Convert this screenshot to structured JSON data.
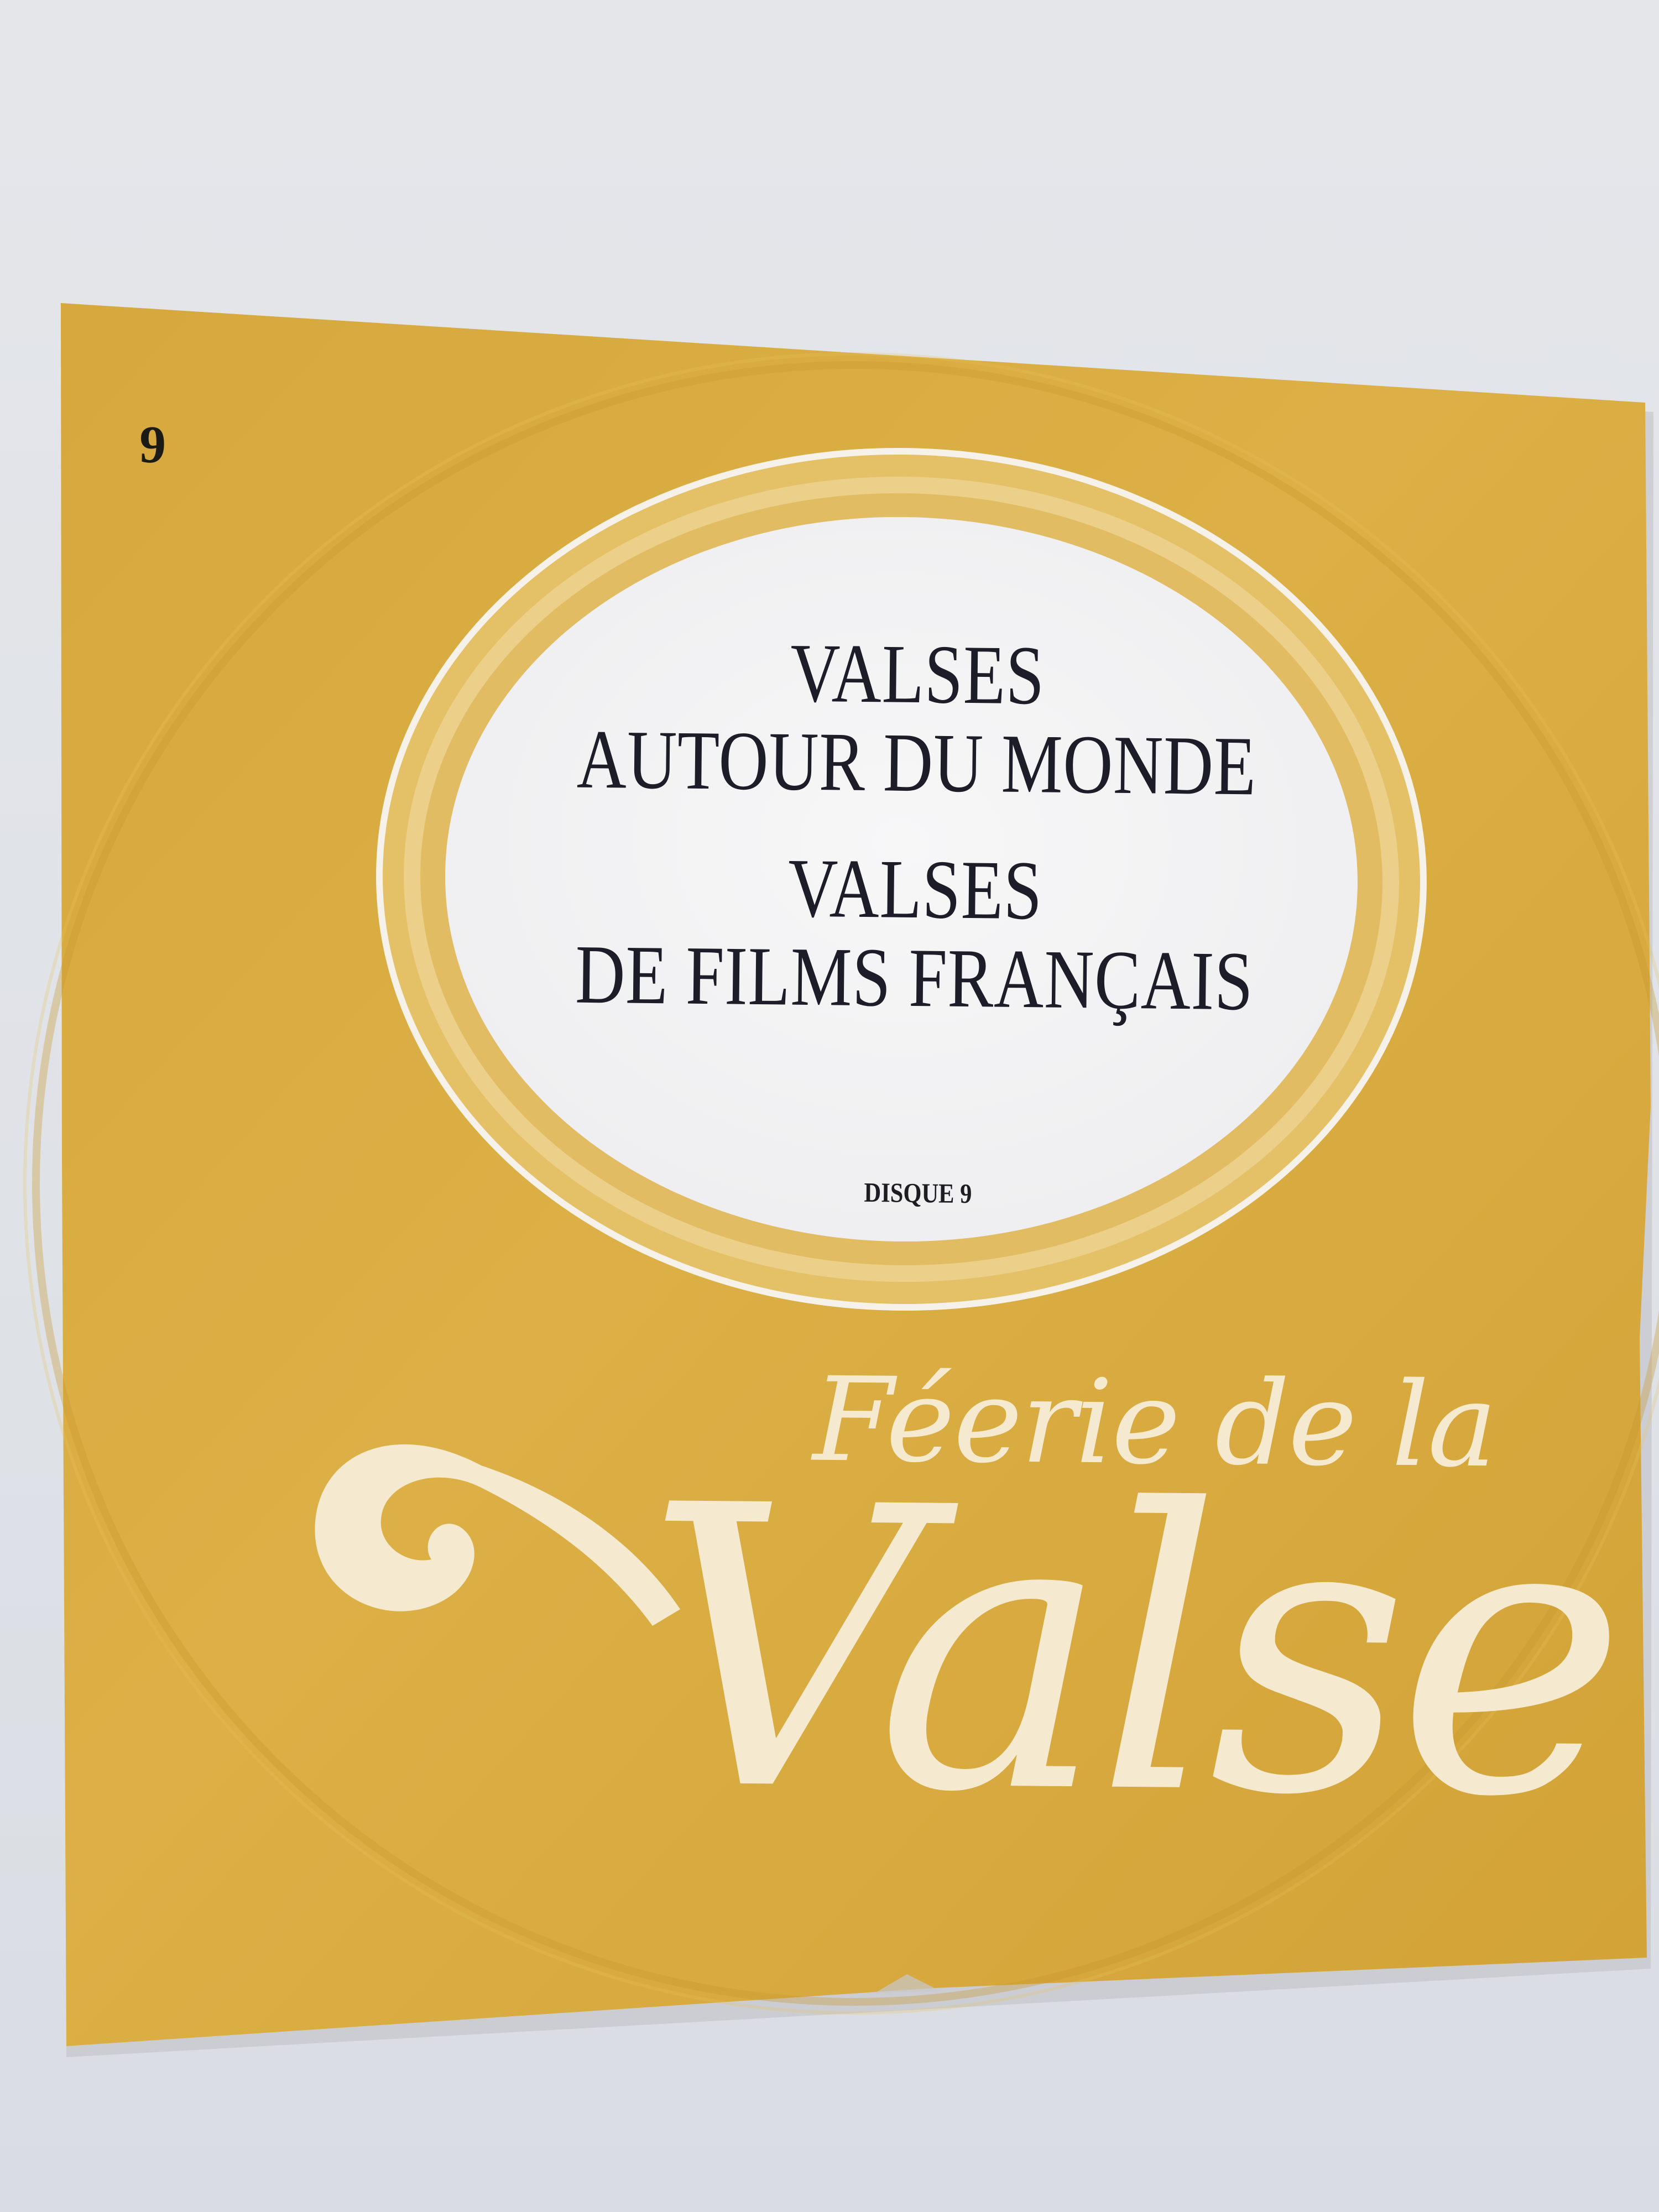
{
  "sleeve": {
    "disc_number": "9",
    "titles": [
      "VALSES",
      "AUTOUR DU MONDE",
      "VALSES",
      "DE FILMS FRANÇAIS"
    ],
    "disque_label": "DISQUE 9",
    "brand_small": "Féerie de la",
    "brand_large": "Valse"
  },
  "colors": {
    "sleeve_gold": "#d8ac40",
    "sleeve_gold_dark": "#c6962b",
    "ring_light": "#e7c877",
    "label_white": "#f4f4f6",
    "script_cream": "#f5ead0",
    "title_ink": "#1d1d2a",
    "background": "#e1e4e8"
  }
}
